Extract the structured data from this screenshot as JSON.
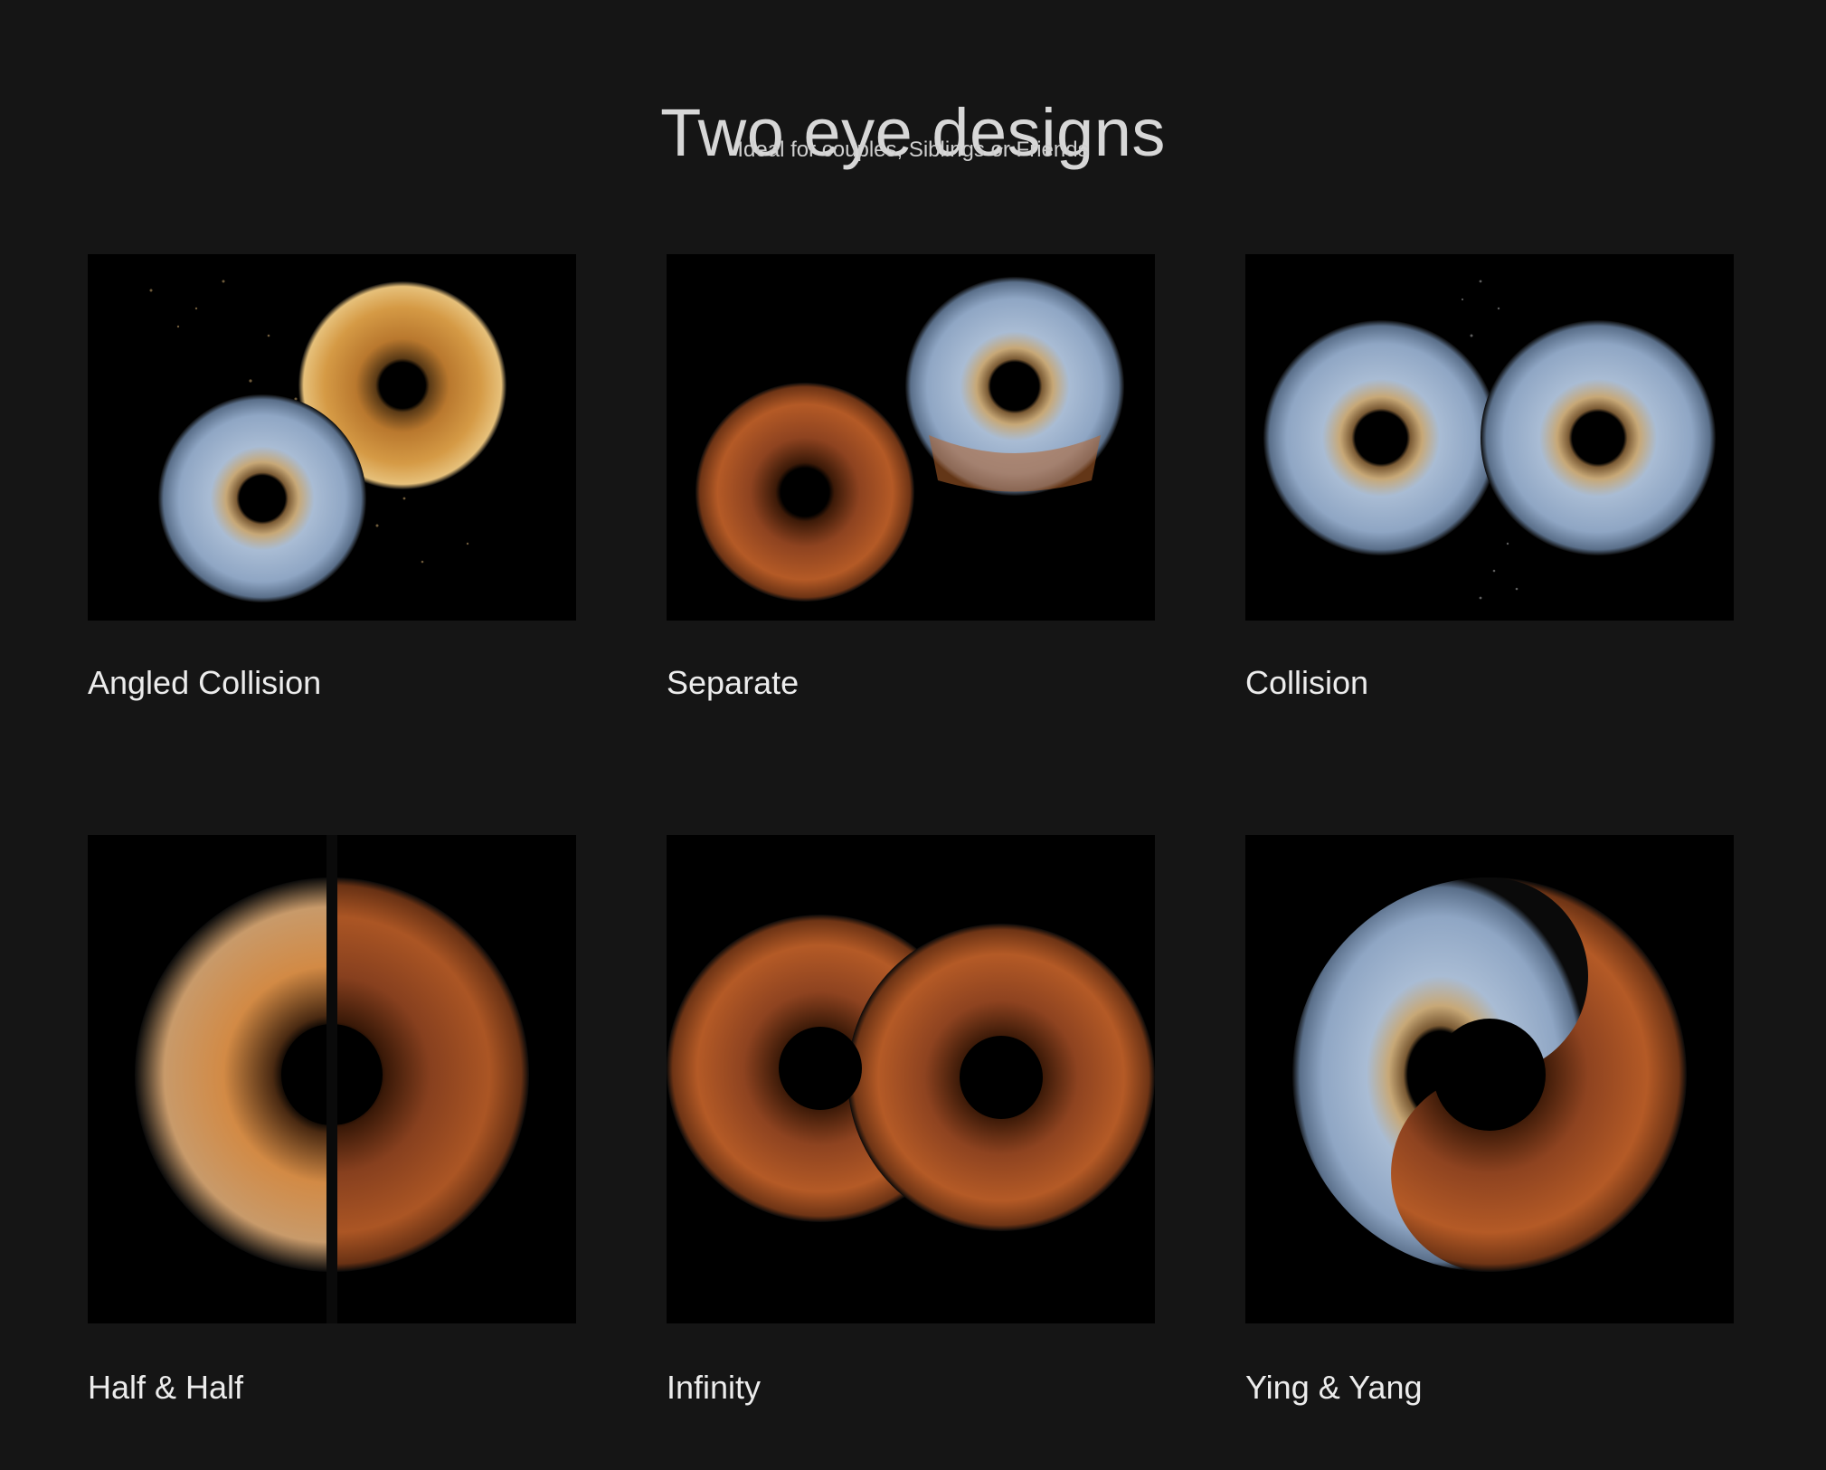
{
  "header": {
    "title": "Two eye designs",
    "subtitle": "Ideal for couples, Siblings or Friends"
  },
  "designs": [
    {
      "label": "Angled Collision",
      "image": "angled-collision-iris-art"
    },
    {
      "label": "Separate",
      "image": "separate-iris-art"
    },
    {
      "label": "Collision",
      "image": "collision-iris-art"
    },
    {
      "label": "Half & Half",
      "image": "half-and-half-iris-art"
    },
    {
      "label": "Infinity",
      "image": "infinity-iris-art"
    },
    {
      "label": "Ying & Yang",
      "image": "ying-and-yang-iris-art"
    }
  ],
  "colors": {
    "background": "#151515",
    "thumb_background": "#000000",
    "blue_iris": "#8fa6c4",
    "amber_iris": "#d59a45",
    "brown_iris": "#b45a26"
  }
}
